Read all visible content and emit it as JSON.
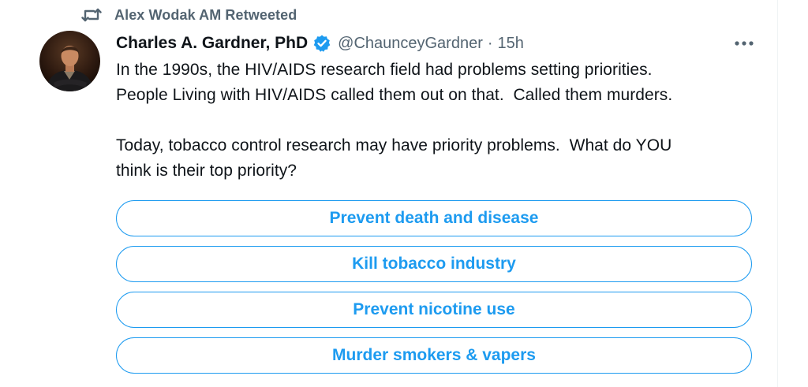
{
  "retweet": {
    "icon": "retweet-icon",
    "label": "Alex Wodak AM Retweeted"
  },
  "tweet": {
    "author": {
      "name": "Charles A. Gardner, PhD",
      "verified_icon": "verified-badge-icon",
      "handle": "@ChaunceyGardner",
      "separator": "·",
      "time": "15h"
    },
    "more_icon": "more-options-icon",
    "body": {
      "paragraph1_line1": "In the 1990s, the HIV/AIDS research field had problems setting priorities.",
      "paragraph1_line2": "People Living with HIV/AIDS called them out on that.  Called them murders.",
      "paragraph2_line1": "Today, tobacco control research may have priority problems.  What do YOU",
      "paragraph2_line2": "think is their top priority?"
    },
    "poll": {
      "options": [
        "Prevent death and disease",
        "Kill tobacco industry",
        "Prevent nicotine use",
        "Murder smokers & vapers"
      ]
    }
  },
  "colors": {
    "accent": "#1d9bf0",
    "text": "#0f1419",
    "secondary": "#536471"
  }
}
